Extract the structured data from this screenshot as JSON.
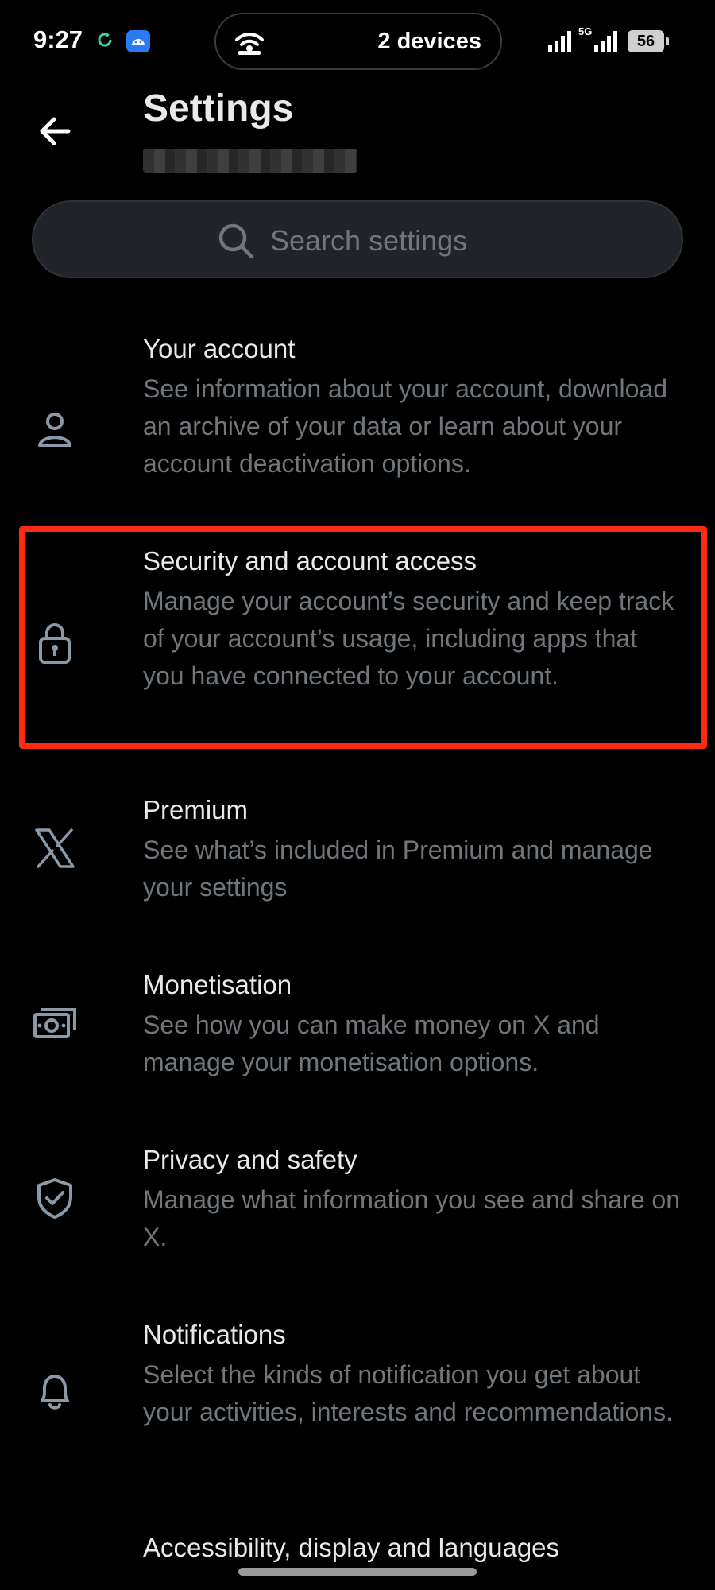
{
  "status_bar": {
    "time": "9:27",
    "devices_label": "2 devices",
    "network_type": "5G",
    "battery_level": "56"
  },
  "header": {
    "title": "Settings",
    "back_icon": "arrow-left-icon"
  },
  "search": {
    "placeholder": "Search settings",
    "value": ""
  },
  "settings": {
    "items": [
      {
        "icon": "person-icon",
        "title": "Your account",
        "description": "See information about your account, download an archive of your data or learn about your account deactivation options."
      },
      {
        "icon": "lock-icon",
        "title": "Security and account access",
        "description": "Manage your account’s security and keep track of your account’s usage, including apps that you have connected to your account.",
        "highlighted": true
      },
      {
        "icon": "x-logo-icon",
        "title": "Premium",
        "description": "See what’s included in Premium and manage your settings"
      },
      {
        "icon": "money-icon",
        "title": "Monetisation",
        "description": "See how you can make money on X and manage your monetisation options."
      },
      {
        "icon": "shield-check-icon",
        "title": "Privacy and safety",
        "description": "Manage what information you see and share on X."
      },
      {
        "icon": "bell-icon",
        "title": "Notifications",
        "description": "Select the kinds of notification you get about your activities, interests and recommendations."
      },
      {
        "icon": "accessibility-icon",
        "title": "Accessibility, display and languages",
        "description": ""
      }
    ]
  },
  "colors": {
    "background": "#000000",
    "primary_text": "#e7e9ea",
    "secondary_text": "#71767b",
    "search_background": "#202327",
    "highlight_border": "#ff2a12"
  }
}
